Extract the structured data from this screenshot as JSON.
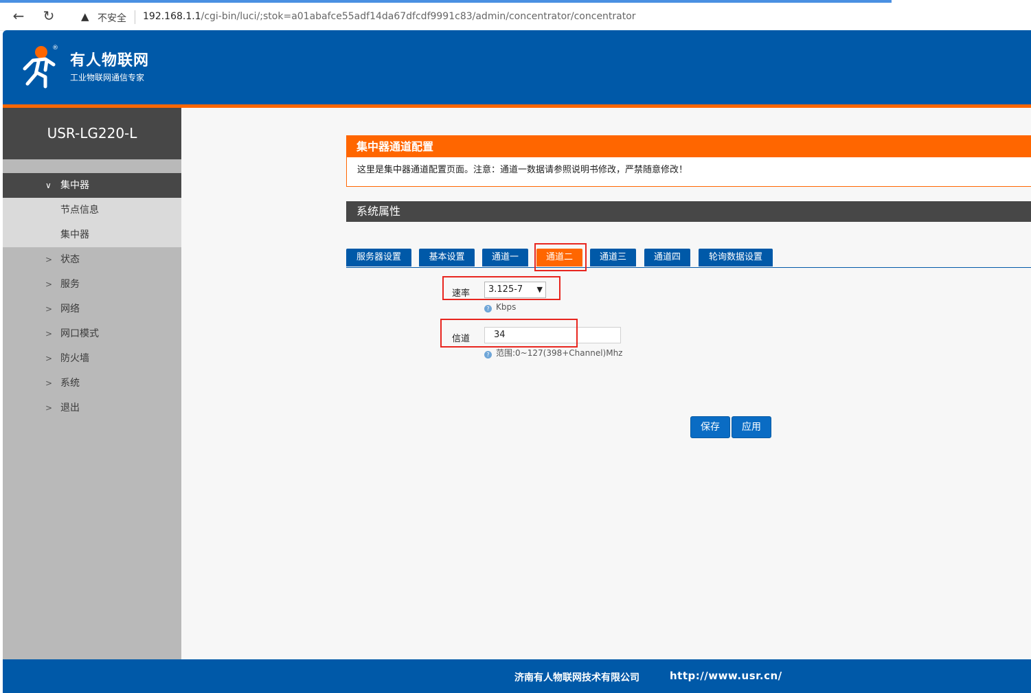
{
  "browser": {
    "back_icon": "←",
    "reload_icon": "↻",
    "security_label": "不安全",
    "url_host": "192.168.1.1",
    "url_path": "/cgi-bin/luci/;stok=a01abafce55adf14da67dfcdf9991c83/admin/concentrator/concentrator"
  },
  "header": {
    "brand_name": "有人物联网",
    "brand_slogan": "工业物联网通信专家",
    "colors": {
      "header_bg": "#0059a8",
      "accent": "#ff6600"
    }
  },
  "sidebar": {
    "device_name": "USR-LG220-L",
    "menu": [
      {
        "label": "集中器",
        "chevron": "∨",
        "active": true
      },
      {
        "label": "节点信息",
        "sub": true
      },
      {
        "label": "集中器",
        "sub": true
      },
      {
        "label": "状态",
        "chevron": ">"
      },
      {
        "label": "服务",
        "chevron": ">"
      },
      {
        "label": "网络",
        "chevron": ">"
      },
      {
        "label": "网口模式",
        "chevron": ">"
      },
      {
        "label": "防火墙",
        "chevron": ">"
      },
      {
        "label": "系统",
        "chevron": ">"
      },
      {
        "label": "退出",
        "chevron": ">"
      }
    ]
  },
  "main": {
    "notice_title": "集中器通道配置",
    "notice_text": "这里是集中器通道配置页面。注意：通道一数据请参照说明书修改，严禁随意修改！",
    "section_title": "系统属性",
    "tabs": [
      "服务器设置",
      "基本设置",
      "通道一",
      "通道二",
      "通道三",
      "通道四",
      "轮询数据设置"
    ],
    "active_tab": "通道二",
    "rate": {
      "label": "速率",
      "value": "3.125-7",
      "hint": "Kbps"
    },
    "channel": {
      "label": "信道",
      "value": "34",
      "hint": "范围:0~127(398+Channel)Mhz"
    },
    "save_label": "保存",
    "apply_label": "应用"
  },
  "footer": {
    "company": "济南有人物联网技术有限公司",
    "url": "http://www.usr.cn/"
  }
}
